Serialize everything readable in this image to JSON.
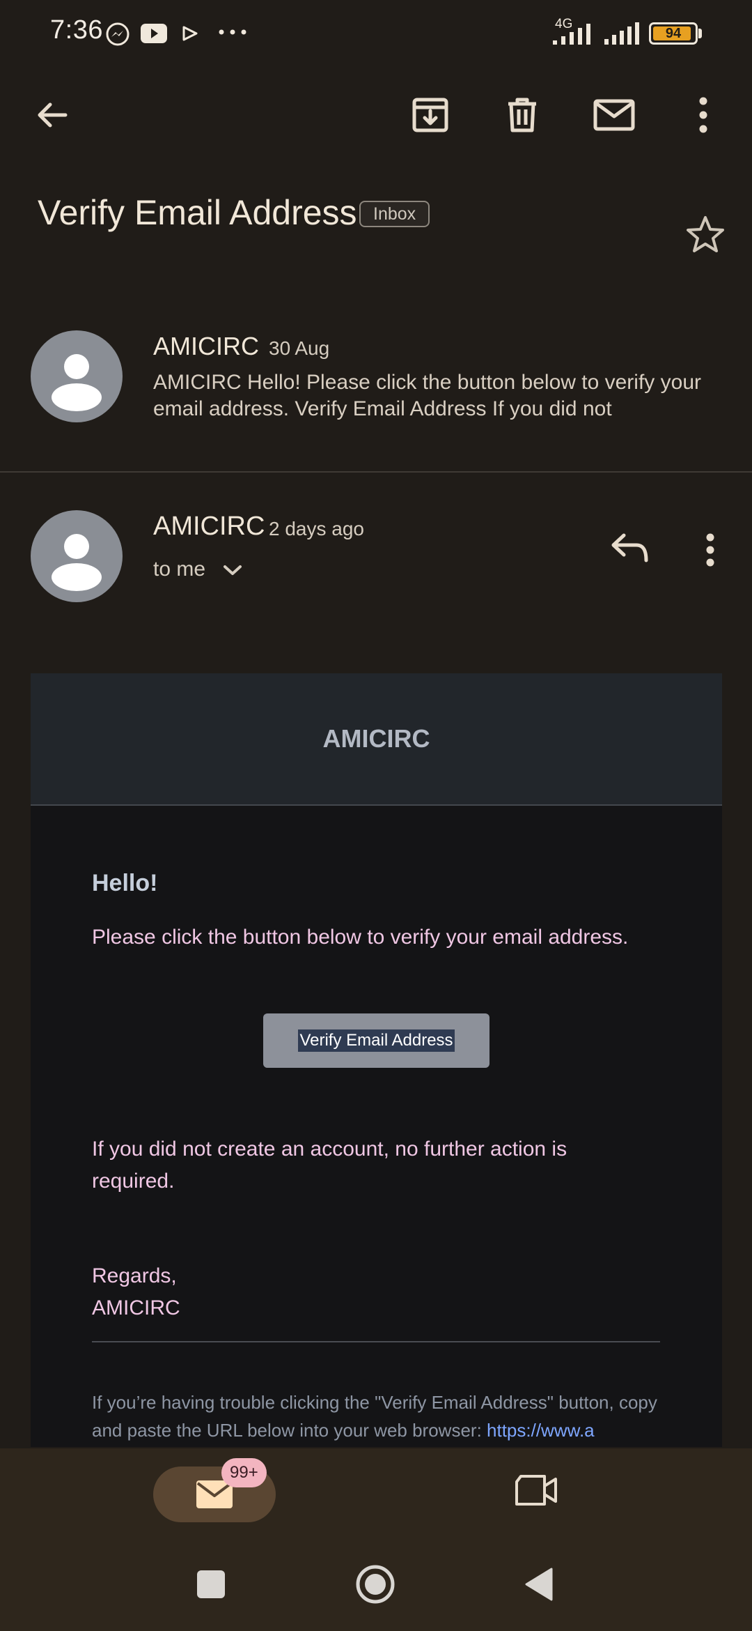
{
  "status_bar": {
    "time": "7:36",
    "network": "4G",
    "battery": "94",
    "battery_level": 0.94,
    "icons": [
      "messenger-icon",
      "youtube-icon",
      "play-icon",
      "more-dots-icon",
      "signal-icon",
      "signal-icon",
      "battery-icon"
    ]
  },
  "toolbar": {
    "icons": [
      "back-arrow-icon",
      "archive-icon",
      "delete-icon",
      "mark-unread-icon",
      "more-vert-icon"
    ]
  },
  "subject": {
    "title": "Verify Email Address",
    "label": "Inbox"
  },
  "message_collapsed": {
    "sender": "AMICIRC",
    "date": "30 Aug",
    "snippet": "AMICIRC Hello! Please click the button below to verify your email address. Verify Email Address If you did not"
  },
  "message_expanded": {
    "sender": "AMICIRC",
    "date": "2 days ago",
    "recipient": "to me"
  },
  "email_body": {
    "brand": "AMICIRC",
    "greeting": "Hello!",
    "intro": "Please click the button below to verify your email address.",
    "button_label": "Verify Email Address",
    "no_action": "If you did not create an account, no further action is required.",
    "regards": "Regards,",
    "signoff": "AMICIRC",
    "trouble_text": "If you’re having trouble clicking the \"Verify Email Address\" button, copy and paste the URL below into your web browser: ",
    "trouble_link": "https://www.a"
  },
  "bottom_nav": {
    "mail_badge": "99+"
  },
  "colors": {
    "background": "#201c18",
    "accent_pink": "#f0c7e4",
    "link": "#7ea6ff",
    "battery": "#e7a021"
  }
}
